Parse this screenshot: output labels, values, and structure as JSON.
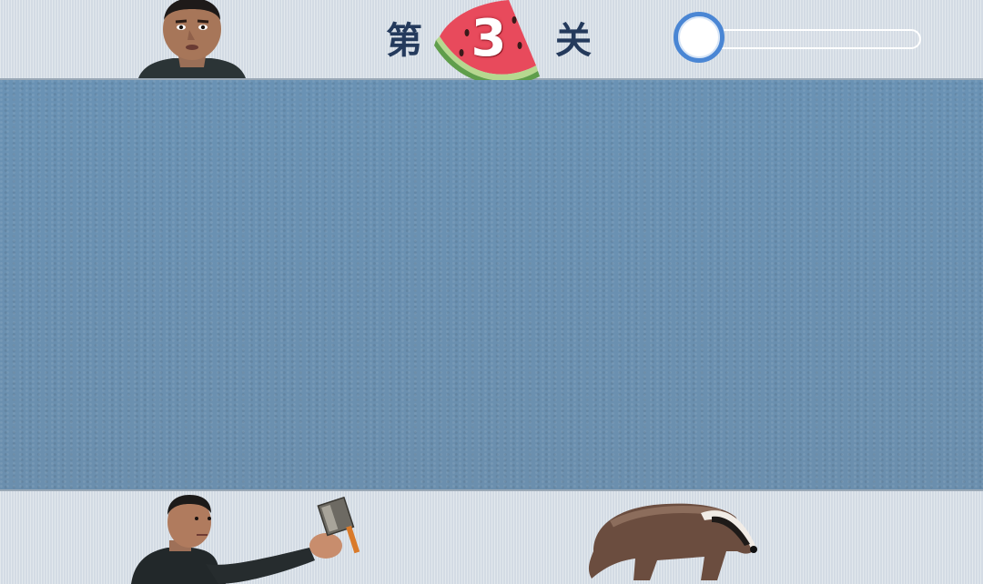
{
  "header": {
    "level_prefix": "第",
    "level_number": "3",
    "level_suffix": "关",
    "level_badge_icon": "watermelon-icon"
  },
  "progress_slider": {
    "value": 0,
    "knob_color": "#4a86d4"
  },
  "characters": {
    "top": "man-portrait",
    "bottom_left": "man-with-cleaver",
    "bottom_right": "badger"
  },
  "colors": {
    "field": "#6c93b3",
    "bars": "#d3dbe4",
    "level_text": "#243a5c"
  }
}
